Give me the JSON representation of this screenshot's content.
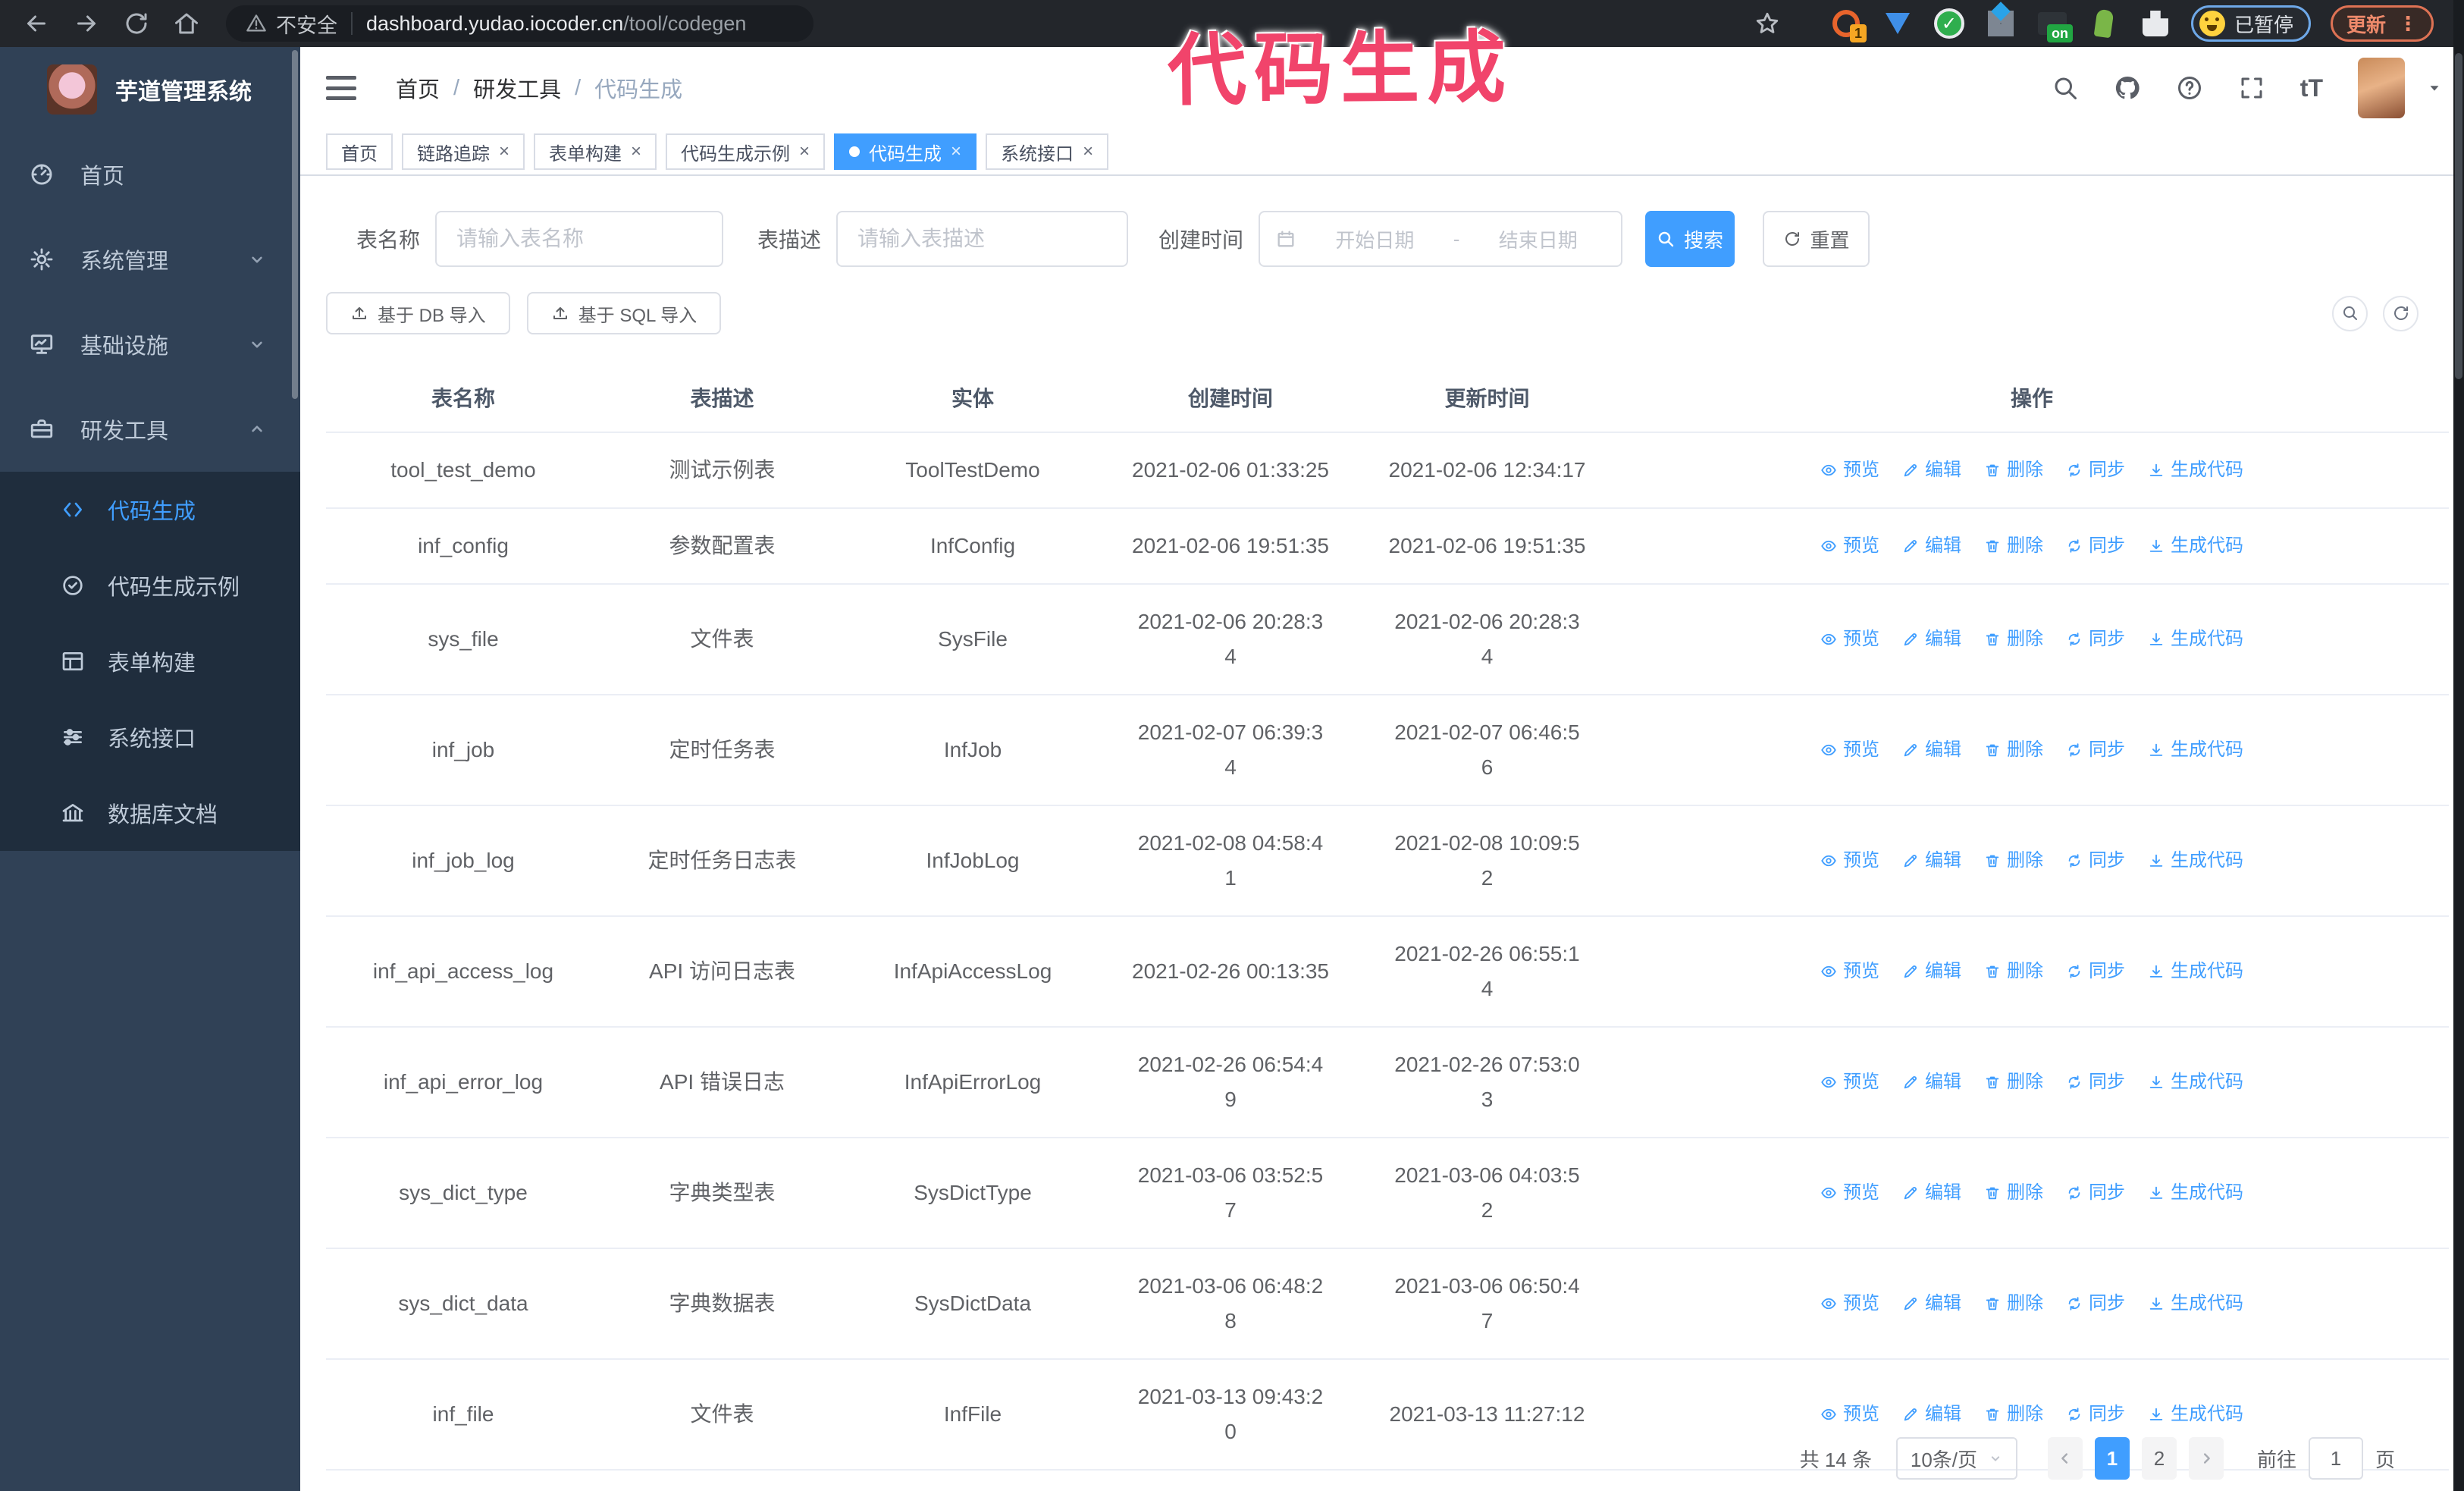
{
  "browser": {
    "security_label": "不安全",
    "url_host": "dashboard.yudao.iocoder.cn",
    "url_path": "/tool/codegen",
    "extension_icons": [
      {
        "name": "orange-circle-badge-icon",
        "shape": "orange-circle-badge",
        "badge": "1"
      },
      {
        "name": "blue-gem-icon",
        "shape": "blue-gem",
        "badge": ""
      },
      {
        "name": "green-check-circle-icon",
        "shape": "green-check-circle",
        "badge": ""
      },
      {
        "name": "grid-diamond-icon",
        "shape": "grid-diamond",
        "badge": ""
      },
      {
        "name": "dark-on-badge-icon",
        "shape": "dark-on-badge",
        "badge": "on"
      },
      {
        "name": "green-plant-icon",
        "shape": "green-plant",
        "badge": ""
      },
      {
        "name": "puzzle-piece-icon",
        "shape": "puzzle-piece",
        "badge": ""
      }
    ],
    "paused_badge": "已暂停",
    "update_button": "更新",
    "kebab_glyph": "⋮"
  },
  "overlay": {
    "text": "代码生成"
  },
  "sidebar": {
    "title": "芋道管理系统",
    "items": [
      {
        "label": "首页",
        "icon": "home",
        "chevron": "",
        "expanded": false
      },
      {
        "label": "系统管理",
        "icon": "gear",
        "chevron": "down",
        "expanded": false
      },
      {
        "label": "基础设施",
        "icon": "monitor",
        "chevron": "down",
        "expanded": false
      },
      {
        "label": "研发工具",
        "icon": "toolbox",
        "chevron": "up",
        "expanded": true
      }
    ],
    "subitems": [
      {
        "label": "代码生成",
        "icon": "code",
        "active": true
      },
      {
        "label": "代码生成示例",
        "icon": "badge-check",
        "active": false
      },
      {
        "label": "表单构建",
        "icon": "form",
        "active": false
      },
      {
        "label": "系统接口",
        "icon": "sliders",
        "active": false
      },
      {
        "label": "数据库文档",
        "icon": "bank",
        "active": false
      }
    ]
  },
  "header": {
    "breadcrumb": [
      "首页",
      "研发工具",
      "代码生成"
    ],
    "separator": "/",
    "help_glyph": "?",
    "text_size_glyph": "tT"
  },
  "tabs": {
    "close_glyph": "×",
    "items": [
      {
        "label": "首页",
        "closable": false,
        "active": false
      },
      {
        "label": "链路追踪",
        "closable": true,
        "active": false
      },
      {
        "label": "表单构建",
        "closable": true,
        "active": false
      },
      {
        "label": "代码生成示例",
        "closable": true,
        "active": false
      },
      {
        "label": "代码生成",
        "closable": true,
        "active": true
      },
      {
        "label": "系统接口",
        "closable": true,
        "active": false
      }
    ]
  },
  "filters": {
    "table_name_label": "表名称",
    "table_name_placeholder": "请输入表名称",
    "table_desc_label": "表描述",
    "table_desc_placeholder": "请输入表描述",
    "create_time_label": "创建时间",
    "date_start_placeholder": "开始日期",
    "date_separator": "-",
    "date_end_placeholder": "结束日期",
    "search_label": "搜索",
    "reset_label": "重置"
  },
  "toolbar": {
    "import_db_label": "基于 DB 导入",
    "import_sql_label": "基于 SQL 导入"
  },
  "table": {
    "columns": [
      "表名称",
      "表描述",
      "实体",
      "创建时间",
      "更新时间",
      "操作"
    ],
    "actions": [
      {
        "label": "预览",
        "icon": "eye"
      },
      {
        "label": "编辑",
        "icon": "pencil"
      },
      {
        "label": "删除",
        "icon": "trash"
      },
      {
        "label": "同步",
        "icon": "sync"
      },
      {
        "label": "生成代码",
        "icon": "download"
      }
    ],
    "rows": [
      {
        "name": "tool_test_demo",
        "desc": "测试示例表",
        "entity": "ToolTestDemo",
        "created": "2021-02-06 01:33:25",
        "updated": "2021-02-06 12:34:17"
      },
      {
        "name": "inf_config",
        "desc": "参数配置表",
        "entity": "InfConfig",
        "created": "2021-02-06 19:51:35",
        "updated": "2021-02-06 19:51:35"
      },
      {
        "name": "sys_file",
        "desc": "文件表",
        "entity": "SysFile",
        "created": "2021-02-06 20:28:3\n4",
        "updated": "2021-02-06 20:28:3\n4"
      },
      {
        "name": "inf_job",
        "desc": "定时任务表",
        "entity": "InfJob",
        "created": "2021-02-07 06:39:3\n4",
        "updated": "2021-02-07 06:46:5\n6"
      },
      {
        "name": "inf_job_log",
        "desc": "定时任务日志表",
        "entity": "InfJobLog",
        "created": "2021-02-08 04:58:4\n1",
        "updated": "2021-02-08 10:09:5\n2"
      },
      {
        "name": "inf_api_access_log",
        "desc": "API 访问日志表",
        "entity": "InfApiAccessLog",
        "created": "2021-02-26 00:13:35",
        "updated": "2021-02-26 06:55:1\n4"
      },
      {
        "name": "inf_api_error_log",
        "desc": "API 错误日志",
        "entity": "InfApiErrorLog",
        "created": "2021-02-26 06:54:4\n9",
        "updated": "2021-02-26 07:53:0\n3"
      },
      {
        "name": "sys_dict_type",
        "desc": "字典类型表",
        "entity": "SysDictType",
        "created": "2021-03-06 03:52:5\n7",
        "updated": "2021-03-06 04:03:5\n2"
      },
      {
        "name": "sys_dict_data",
        "desc": "字典数据表",
        "entity": "SysDictData",
        "created": "2021-03-06 06:48:2\n8",
        "updated": "2021-03-06 06:50:4\n7"
      },
      {
        "name": "inf_file",
        "desc": "文件表",
        "entity": "InfFile",
        "created": "2021-03-13 09:43:2\n0",
        "updated": "2021-03-13 11:27:12"
      }
    ]
  },
  "pagination": {
    "total": "共 14 条",
    "page_size": "10条/页",
    "pages": [
      "1",
      "2"
    ],
    "current": "1",
    "goto_label": "前往",
    "goto_value": "1",
    "page_label": "页"
  },
  "colors": {
    "accent": "#409eff",
    "sidebar_bg": "#304156",
    "submenu_bg": "#1f2d3d",
    "overlay_pink": "#f1446b"
  }
}
